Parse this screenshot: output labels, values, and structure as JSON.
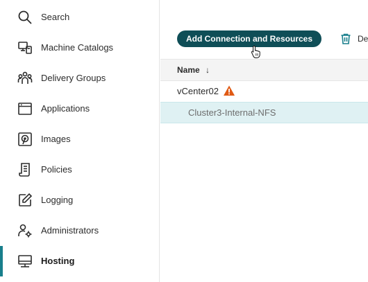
{
  "sidebar": {
    "items": [
      {
        "label": "Search",
        "icon": "search-icon"
      },
      {
        "label": "Machine Catalogs",
        "icon": "machine-catalogs-icon"
      },
      {
        "label": "Delivery Groups",
        "icon": "delivery-groups-icon"
      },
      {
        "label": "Applications",
        "icon": "applications-icon"
      },
      {
        "label": "Images",
        "icon": "images-icon"
      },
      {
        "label": "Policies",
        "icon": "policies-icon"
      },
      {
        "label": "Logging",
        "icon": "logging-icon"
      },
      {
        "label": "Administrators",
        "icon": "administrators-icon"
      },
      {
        "label": "Hosting",
        "icon": "hosting-icon",
        "active": true
      }
    ]
  },
  "toolbar": {
    "add_label": "Add Connection and Resources",
    "delete_label": "Delete"
  },
  "table": {
    "name_header": "Name",
    "sort_indicator": "↓",
    "rows": [
      {
        "label": "vCenter02",
        "status": "warning"
      },
      {
        "label": "Cluster3-Internal-NFS",
        "selected": true
      }
    ]
  },
  "colors": {
    "accent": "#187f8c",
    "primary_button": "#0f4e57",
    "selected_row": "#dff1f3",
    "warning": "#e05a14"
  }
}
